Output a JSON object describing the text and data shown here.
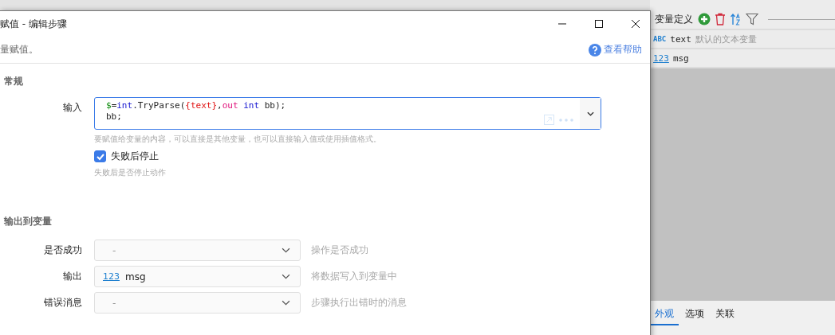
{
  "window": {
    "title": "赋值 - 编辑步骤",
    "subtitle": "量赋值。",
    "help_link": "查看帮助"
  },
  "sections": [
    {
      "title": "常规"
    },
    {
      "title": "输出到变量"
    }
  ],
  "input": {
    "label": "输入",
    "lines": [
      [
        {
          "kind": "var",
          "text": "$"
        },
        {
          "kind": "plain",
          "text": "="
        },
        {
          "kind": "keyword",
          "text": "int"
        },
        {
          "kind": "plain",
          "text": ".TryParse("
        },
        {
          "kind": "interp",
          "text": "{text}"
        },
        {
          "kind": "plain",
          "text": ","
        },
        {
          "kind": "modifier",
          "text": "out"
        },
        {
          "kind": "keyword",
          "text": " int"
        },
        {
          "kind": "plain",
          "text": " bb);"
        }
      ],
      [
        {
          "kind": "plain",
          "text": "bb;"
        }
      ]
    ],
    "hint": "要赋值给变量的内容，可以直接是其他变量，也可以直接输入值或使用插值格式。"
  },
  "stop_on_fail": {
    "label": "失败后停止",
    "checked": true,
    "hint": "失败后是否停止动作"
  },
  "outputs": [
    {
      "label": "是否成功",
      "placeholder": "-",
      "hint": "操作是否成功"
    },
    {
      "label": "输出",
      "value": "msg",
      "type_badge": "123",
      "hint": "将数据写入到变量中"
    },
    {
      "label": "错误消息",
      "placeholder": "-",
      "hint": "步骤执行出错时的消息"
    }
  ],
  "side_panel": {
    "title": "变量定义",
    "variables": [
      {
        "badge": "ABC",
        "name": "text",
        "description": "默认的文本变量",
        "selected": false
      },
      {
        "badge": "123",
        "name": "msg",
        "selected": false
      }
    ],
    "tabs": [
      {
        "label": "外观",
        "selected": true
      },
      {
        "label": "选项",
        "selected": false
      },
      {
        "label": "关联",
        "selected": false
      }
    ]
  }
}
